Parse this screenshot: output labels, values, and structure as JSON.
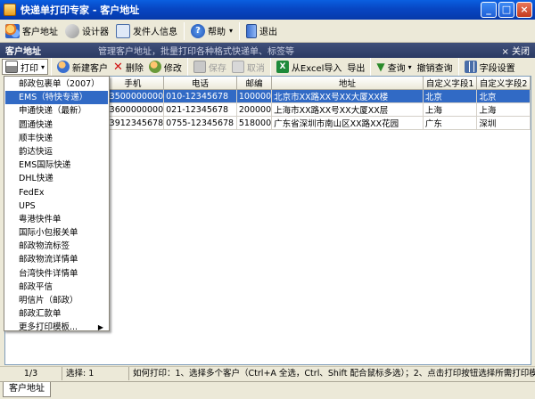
{
  "window": {
    "title": "快递单打印专家 - 客户地址"
  },
  "main_toolbar": {
    "items": [
      {
        "label": "客户地址",
        "icon": "customers-icon"
      },
      {
        "label": "设计器",
        "icon": "designer-icon"
      },
      {
        "label": "发件人信息",
        "icon": "sender-card-icon"
      },
      {
        "label": "帮助",
        "icon": "help-icon"
      },
      {
        "label": "退出",
        "icon": "exit-door-icon"
      }
    ]
  },
  "panel": {
    "title": "客户地址",
    "description": "管理客户地址，批量打印各种格式快递单、标签等",
    "close_label": "关闭"
  },
  "sub_toolbar": {
    "print": "打印",
    "new_customer": "新建客户",
    "delete": "删除",
    "edit": "修改",
    "save": "保存",
    "cancel": "取消",
    "import_excel": "从Excel导入",
    "export": "导出",
    "query": "查询",
    "undo_query": "撤销查询",
    "field_settings": "字段设置"
  },
  "table": {
    "columns": [
      "手机",
      "电话",
      "邮编",
      "地址",
      "自定义字段1",
      "自定义字段2"
    ],
    "rows": [
      [
        "13500000000",
        "010-12345678",
        "100000",
        "北京市XX路XX号XX大厦XX楼",
        "北京",
        "北京"
      ],
      [
        "13600000000",
        "021-12345678",
        "200000",
        "上海市XX路XX号XX大厦XX层",
        "上海",
        "上海"
      ],
      [
        "13912345678",
        "0755-12345678",
        "518000",
        "广东省深圳市南山区XX路XX花园",
        "广东",
        "深圳"
      ]
    ]
  },
  "print_menu": {
    "items": [
      "邮政包裹单（2007）",
      "EMS（特快专递）",
      "申通快递（最新）",
      "圆通快递",
      "顺丰快递",
      "韵达快运",
      "EMS国际快递",
      "DHL快递",
      "FedEx",
      "UPS",
      "粤港快件单",
      "国际小包报关单",
      "邮政物流标签",
      "邮政物流详情单",
      "台湾快件详情单",
      "邮政平信",
      "明信片（邮政）",
      "邮政汇款单",
      "更多打印模板..."
    ],
    "highlighted_index": 1
  },
  "status": {
    "page": "1/3",
    "selected": "选择: 1",
    "hint": "如何打印：1、选择多个客户（Ctrl+A 全选，Ctrl、Shift 配合鼠标多选）；2、点击打印按钮选择所需打印模板"
  },
  "bottom_tab": "客户地址"
}
